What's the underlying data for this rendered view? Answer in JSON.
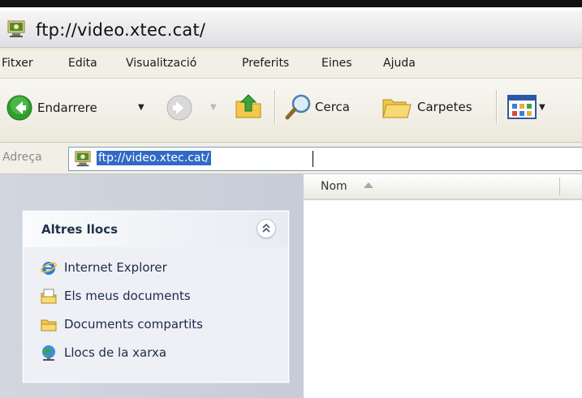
{
  "window": {
    "title": "ftp://video.xtec.cat/"
  },
  "menubar": {
    "items": [
      "Fitxer",
      "Edita",
      "Visualització",
      "Preferits",
      "Eines",
      "Ajuda"
    ]
  },
  "toolbar": {
    "back_label": "Endarrere",
    "search_label": "Cerca",
    "folders_label": "Carpetes",
    "icons": [
      "back-arrow-icon",
      "forward-arrow-icon",
      "folder-up-icon",
      "search-magnifier-icon",
      "folders-icon",
      "views-icon"
    ]
  },
  "addressbar": {
    "label": "Adreça",
    "value": "ftp://video.xtec.cat/"
  },
  "taskpane": {
    "section_title": "Altres llocs",
    "links": [
      {
        "label": "Internet Explorer",
        "icon": "internet-explorer-icon"
      },
      {
        "label": "Els meus documents",
        "icon": "my-documents-icon"
      },
      {
        "label": "Documents compartits",
        "icon": "shared-documents-icon"
      },
      {
        "label": "Llocs de la xarxa",
        "icon": "network-places-icon"
      }
    ]
  },
  "filelist": {
    "columns": [
      "Nom"
    ],
    "sort": "ascending"
  },
  "colors": {
    "selection": "#316ac5",
    "address_border": "#7f9db9",
    "taskpane_title": "#22324a"
  }
}
